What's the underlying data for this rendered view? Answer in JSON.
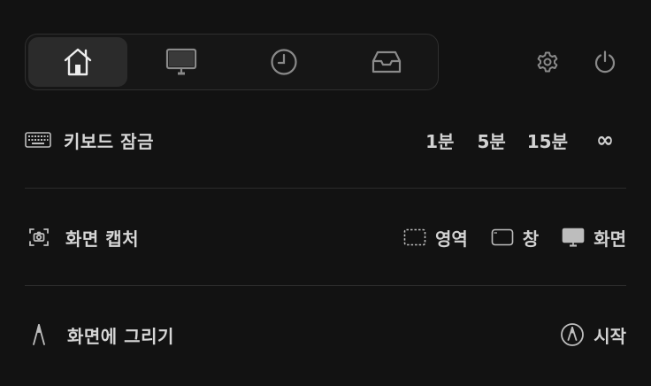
{
  "tabs": [
    {
      "name": "home",
      "icon": "home-icon",
      "active": true
    },
    {
      "name": "display",
      "icon": "monitor-icon",
      "active": false
    },
    {
      "name": "timer",
      "icon": "clock-icon",
      "active": false
    },
    {
      "name": "tray",
      "icon": "inbox-icon",
      "active": false
    }
  ],
  "top_actions": [
    {
      "icon": "gear-icon"
    },
    {
      "icon": "power-icon"
    }
  ],
  "keyboard_lock": {
    "label": "키보드 잠금",
    "icon": "keyboard-icon",
    "options": [
      "1분",
      "5분",
      "15분",
      "∞"
    ]
  },
  "screen_capture": {
    "label": "화면 캡처",
    "icon": "camera-icon",
    "options": [
      {
        "label": "영역",
        "icon": "dashed-region-icon"
      },
      {
        "label": "창",
        "icon": "window-icon"
      },
      {
        "label": "화면",
        "icon": "monitor-icon"
      }
    ]
  },
  "screen_draw": {
    "label": "화면에 그리기",
    "icon": "pen-nib-icon",
    "action": {
      "label": "시작",
      "icon": "pen-circle-icon"
    }
  },
  "colors": {
    "background": "#121212",
    "active_tab": "#2b2b2b",
    "text": "#d2d2d2",
    "divider": "#2b2b2b"
  }
}
